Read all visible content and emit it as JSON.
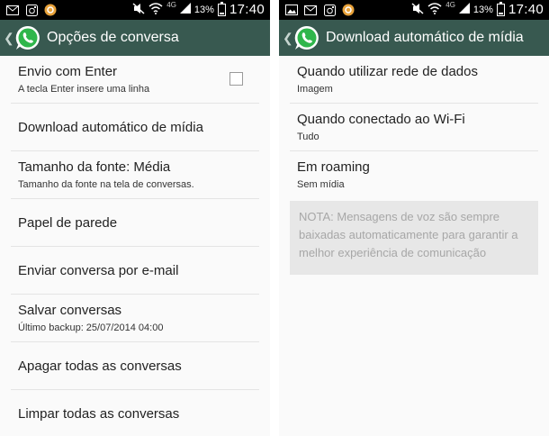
{
  "status_bar": {
    "network_label": "4G",
    "battery_percent": "13%",
    "time": "17:40"
  },
  "left_screen": {
    "title": "Opções de conversa",
    "items": [
      {
        "title": "Envio com Enter",
        "subtitle": "A tecla Enter insere uma linha"
      },
      {
        "title": "Download automático de mídia"
      },
      {
        "title": "Tamanho da fonte: Média",
        "subtitle": "Tamanho da fonte na tela de conversas."
      },
      {
        "title": "Papel de parede"
      },
      {
        "title": "Enviar conversa por e-mail"
      },
      {
        "title": "Salvar conversas",
        "subtitle": "Último backup: 25/07/2014 04:00"
      },
      {
        "title": "Apagar todas as conversas"
      },
      {
        "title": "Limpar todas as conversas"
      }
    ]
  },
  "right_screen": {
    "title": "Download automático de mídia",
    "items": [
      {
        "title": "Quando utilizar rede de dados",
        "subtitle": "Imagem"
      },
      {
        "title": "Quando conectado ao Wi-Fi",
        "subtitle": "Tudo"
      },
      {
        "title": "Em roaming",
        "subtitle": "Sem mídia"
      }
    ],
    "note": "NOTA: Mensagens de voz são sempre baixadas automaticamente para garantir a melhor experiência de comunicação"
  }
}
